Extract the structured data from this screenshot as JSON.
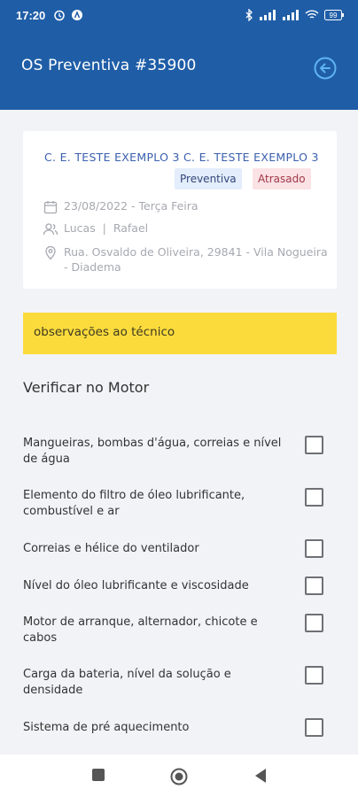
{
  "statusbar": {
    "time": "17:20",
    "battery": "99"
  },
  "appbar": {
    "title": "OS Preventiva #35900"
  },
  "card": {
    "client": "C. E. TESTE EXEMPLO 3 C. E. TESTE EXEMPLO 3",
    "badges": {
      "type": "Preventiva",
      "status": "Atrasado"
    },
    "date": "23/08/2022 - Terça Feira",
    "technicians": "Lucas  |  Rafael",
    "address": "Rua. Osvaldo de Oliveira, 29841 - Vila Nogueira - Diadema"
  },
  "observations": {
    "label": "observações ao técnico"
  },
  "section": {
    "title": "Verificar no Motor"
  },
  "checklist": [
    "Mangueiras, bombas d'água, correias e nível de água",
    "Elemento do filtro de óleo lubrificante, combustível e ar",
    "Correias e hélice do ventilador",
    "Nível do óleo lubrificante e viscosidade",
    "Motor de arranque, alternador, chicote e cabos",
    "Carga da bateria, nível da solução e densidade",
    "Sistema de pré aquecimento"
  ],
  "colors": {
    "primary": "#1f5ea7",
    "obs": "#fbdb3c"
  }
}
